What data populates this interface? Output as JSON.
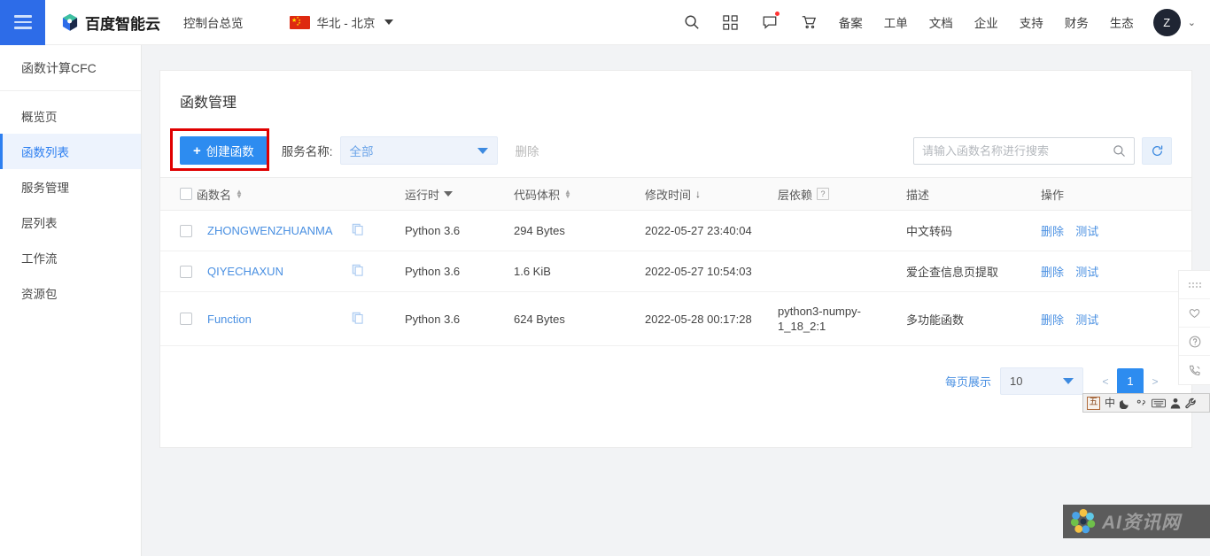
{
  "header": {
    "menu_icon": "hamburger-icon",
    "brand": "百度智能云",
    "console_link": "控制台总览",
    "region": "华北 - 北京",
    "icons": [
      "search-icon",
      "grid-icon",
      "message-icon",
      "cart-icon"
    ],
    "links": [
      "备案",
      "工单",
      "文档",
      "企业",
      "支持",
      "财务",
      "生态"
    ],
    "avatar_initial": "Z"
  },
  "sidebar": {
    "title": "函数计算CFC",
    "items": [
      {
        "label": "概览页",
        "active": false
      },
      {
        "label": "函数列表",
        "active": true
      },
      {
        "label": "服务管理",
        "active": false
      },
      {
        "label": "层列表",
        "active": false
      },
      {
        "label": "工作流",
        "active": false
      },
      {
        "label": "资源包",
        "active": false
      }
    ]
  },
  "main": {
    "card_title": "函数管理",
    "toolbar": {
      "create_label": "创建函数",
      "create_plus": "+",
      "filter_label": "服务名称:",
      "service_value": "全部",
      "delete_label": "删除",
      "annotation": "red-highlight-box"
    },
    "search": {
      "placeholder": "请输入函数名称进行搜索",
      "value": "",
      "icon": "search-icon",
      "refresh_icon": "refresh-icon"
    },
    "table": {
      "columns": [
        {
          "label": "函数名",
          "affordance": "sort"
        },
        {
          "label": "运行时",
          "affordance": "filter"
        },
        {
          "label": "代码体积",
          "affordance": "sort"
        },
        {
          "label": "修改时间",
          "affordance": "sort-desc"
        },
        {
          "label": "层依赖",
          "affordance": "help"
        },
        {
          "label": "描述",
          "affordance": "none"
        },
        {
          "label": "操作",
          "affordance": "none"
        }
      ],
      "rows": [
        {
          "name": "ZHONGWENZHUANMA",
          "runtime": "Python 3.6",
          "size": "294 Bytes",
          "modified": "2022-05-27 23:40:04",
          "layer": "",
          "description": "中文转码",
          "action_delete": "删除",
          "action_test": "测试"
        },
        {
          "name": "QIYECHAXUN",
          "runtime": "Python 3.6",
          "size": "1.6 KiB",
          "modified": "2022-05-27 10:54:03",
          "layer": "",
          "description": "爱企查信息页提取",
          "action_delete": "删除",
          "action_test": "测试"
        },
        {
          "name": "Function",
          "runtime": "Python 3.6",
          "size": "624 Bytes",
          "modified": "2022-05-28 00:17:28",
          "layer": "python3-numpy-1_18_2:1",
          "description": "多功能函数",
          "action_delete": "删除",
          "action_test": "测试"
        }
      ]
    },
    "pagination": {
      "per_page_label": "每页展示",
      "per_page_value": "10",
      "prev": "<",
      "next": ">",
      "current_page": "1"
    }
  },
  "rail": {
    "items": [
      "drag-grip-icon",
      "heart-icon",
      "question-icon",
      "phone-icon"
    ]
  },
  "ime": {
    "items": [
      "五",
      "中",
      "moon-icon",
      "punctuation-icon",
      "keyboard-icon",
      "person-icon",
      "wrench-icon"
    ]
  },
  "watermark": {
    "text": "AI资讯网",
    "logo": "flower-logo"
  },
  "colors": {
    "accent": "#2d8cf0",
    "brand_blue": "#2d6ce8",
    "link": "#4a90e2",
    "annotation_red": "#e00000",
    "page_bg": "#f2f3f5"
  }
}
